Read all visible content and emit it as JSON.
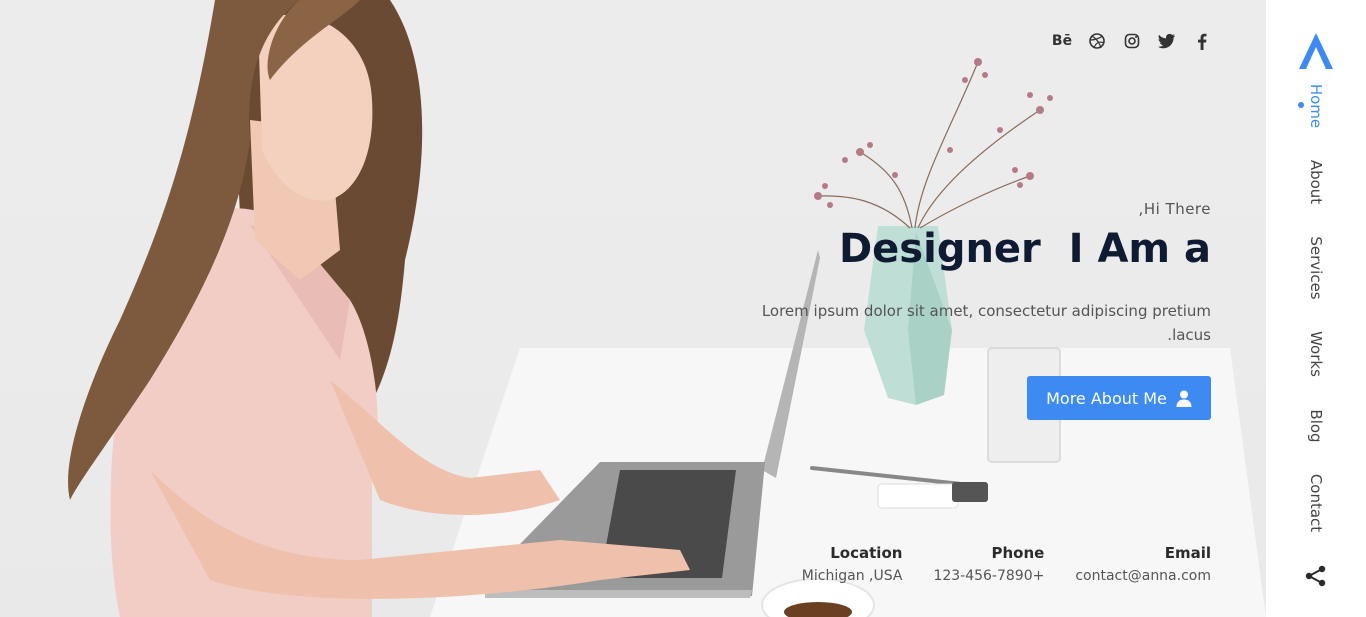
{
  "social": {
    "behance_label": "Bē",
    "icons": [
      "behance-icon",
      "dribbble-icon",
      "instagram-icon",
      "twitter-icon",
      "facebook-icon"
    ]
  },
  "hero": {
    "greeting": ",Hi There",
    "headline": "Designer  I Am a",
    "description": "Lorem ipsum dolor sit amet, consectetur adipiscing pretium .lacus",
    "cta_label": "More About Me",
    "cta_icon": "user-icon"
  },
  "contact": {
    "location_label": "Location",
    "location_value": "Michigan ,USA",
    "phone_label": "Phone",
    "phone_value": "123-456-7890+",
    "email_label": "Email",
    "email_value": "contact@anna.com"
  },
  "sidebar": {
    "logo_icon": "logo-a-icon",
    "items": [
      {
        "label": "Home",
        "active": true
      },
      {
        "label": "About"
      },
      {
        "label": "Services"
      },
      {
        "label": "Works"
      },
      {
        "label": "Blog"
      },
      {
        "label": "Contact"
      }
    ],
    "share_icon": "share-icon"
  },
  "colors": {
    "accent": "#3d8bf2",
    "headline": "#0f1b33",
    "body_text": "#555555"
  }
}
